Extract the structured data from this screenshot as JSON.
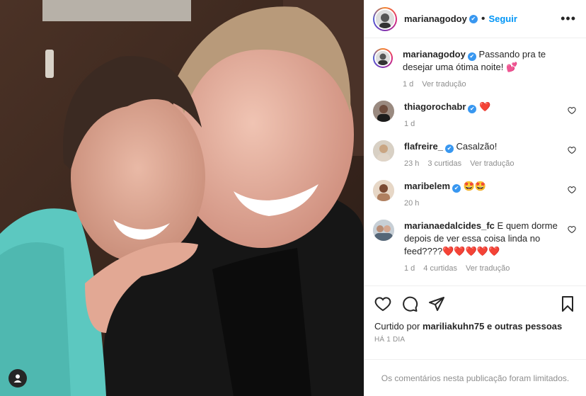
{
  "post": {
    "author": "marianagodoy",
    "follow_label": "Seguir",
    "more_label": "•••",
    "separator": "•"
  },
  "caption": {
    "author": "marianagodoy",
    "text": "Passando pra te desejar uma ótima noite! 💕",
    "time": "1 d",
    "translate": "Ver tradução"
  },
  "comments": [
    {
      "user": "thiagorochabr",
      "verified": true,
      "text": "❤️",
      "time": "1 d",
      "likes": "",
      "translate": ""
    },
    {
      "user": "flafreire_",
      "verified": true,
      "text": "Casalzão!",
      "time": "23 h",
      "likes": "3 curtidas",
      "translate": "Ver tradução"
    },
    {
      "user": "maribelem",
      "verified": true,
      "text": "🤩🤩",
      "time": "20 h",
      "likes": "",
      "translate": ""
    },
    {
      "user": "marianaedalcides_fc",
      "verified": false,
      "text": "E quem dorme depois de ver essa coisa linda no feed????❤️❤️❤️❤️❤️",
      "time": "1 d",
      "likes": "4 curtidas",
      "translate": "Ver tradução"
    }
  ],
  "likes_line": {
    "prefix": "Curtido por",
    "user": "mariliakuhn75",
    "suffix": "e outras pessoas"
  },
  "timestamp": "HÁ 1 DIA",
  "limited_notice": "Os comentários nesta publicação foram limitados.",
  "colors": {
    "accent": "#0095f6",
    "verified": "#3897f0",
    "heart": "#ed4956",
    "muted": "#8e8e8e"
  }
}
